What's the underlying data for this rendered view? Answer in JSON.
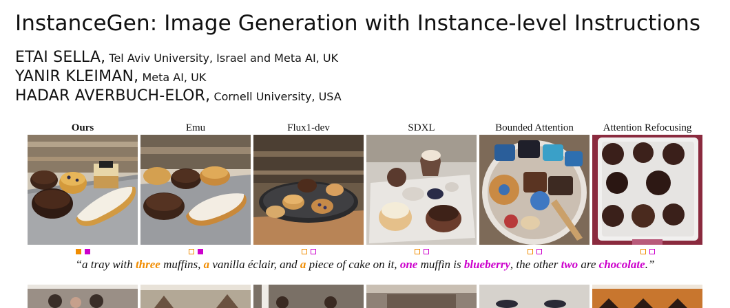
{
  "paper": {
    "title": "InstanceGen: Image Generation with Instance-level Instructions",
    "authors": [
      {
        "name": "ETAI SELLA,",
        "affiliation": "Tel Aviv University, Israel and Meta AI, UK"
      },
      {
        "name": "YANIR KLEIMAN,",
        "affiliation": "Meta AI, UK"
      },
      {
        "name": "HADAR AVERBUCH-ELOR,",
        "affiliation": "Cornell University, USA"
      }
    ]
  },
  "figure": {
    "columns": [
      "Ours",
      "Emu",
      "Flux1-dev",
      "SDXL",
      "Bounded Attention",
      "Attention Refocusing"
    ],
    "caption": {
      "open_quote": "“",
      "t1": "a tray with ",
      "count_muffins": "three",
      "t2": " muffins, ",
      "count_eclair": "a",
      "t3": " vanilla éclair, and ",
      "count_cake": "a",
      "t4": " piece of cake on it, ",
      "count_blueberry": "one",
      "t5": " muffin is ",
      "word_blueberry": "blueberry",
      "t6": ", the other ",
      "count_chocolate": "two",
      "t7": " are ",
      "word_chocolate": "chocolate",
      "close": ".”"
    },
    "colors": {
      "orange": "#f08c00",
      "purple": "#cc00cc"
    },
    "marks": [
      {
        "orange": "filled",
        "purple": "filled"
      },
      {
        "orange": "outline",
        "purple": "filled"
      },
      {
        "orange": "outline",
        "purple": "outline"
      },
      {
        "orange": "outline",
        "purple": "outline"
      },
      {
        "orange": "outline",
        "purple": "outline"
      },
      {
        "orange": "outline",
        "purple": "outline"
      }
    ]
  }
}
